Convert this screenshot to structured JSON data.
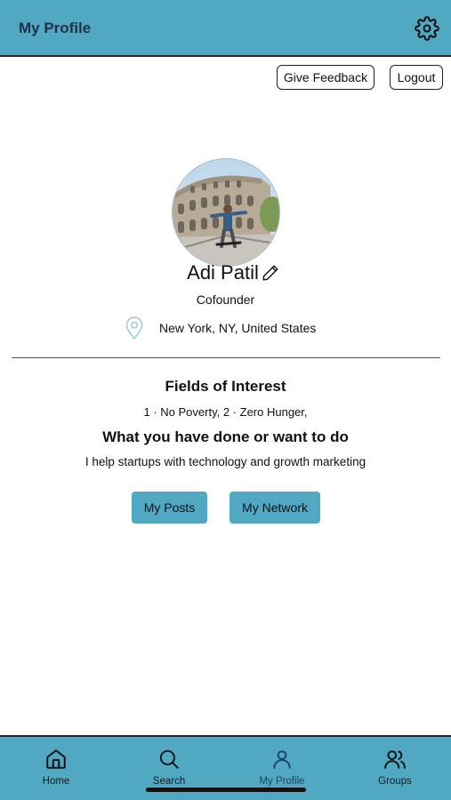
{
  "header": {
    "title": "My Profile",
    "settings_icon": "gear-icon"
  },
  "actions": {
    "feedback_label": "Give Feedback",
    "logout_label": "Logout"
  },
  "profile": {
    "name": "Adi Patil",
    "role": "Cofounder",
    "location": "New York, NY, United States",
    "avatar_description": "photo-avatar"
  },
  "interests": {
    "heading": "Fields of Interest",
    "items": "1 · No Poverty, 2 · Zero Hunger,"
  },
  "about": {
    "heading": "What you have done or want to do",
    "text": "I help startups with technology and growth marketing"
  },
  "buttons": {
    "posts": "My Posts",
    "network": "My Network"
  },
  "tabs": [
    {
      "label": "Home",
      "icon": "home-icon"
    },
    {
      "label": "Search",
      "icon": "search-icon"
    },
    {
      "label": "My Profile",
      "icon": "user-icon",
      "active": true
    },
    {
      "label": "Groups",
      "icon": "users-icon"
    }
  ],
  "colors": {
    "accent": "#50a8c2",
    "title": "#1f3147",
    "active_tab_label": "#1f3f6b"
  }
}
